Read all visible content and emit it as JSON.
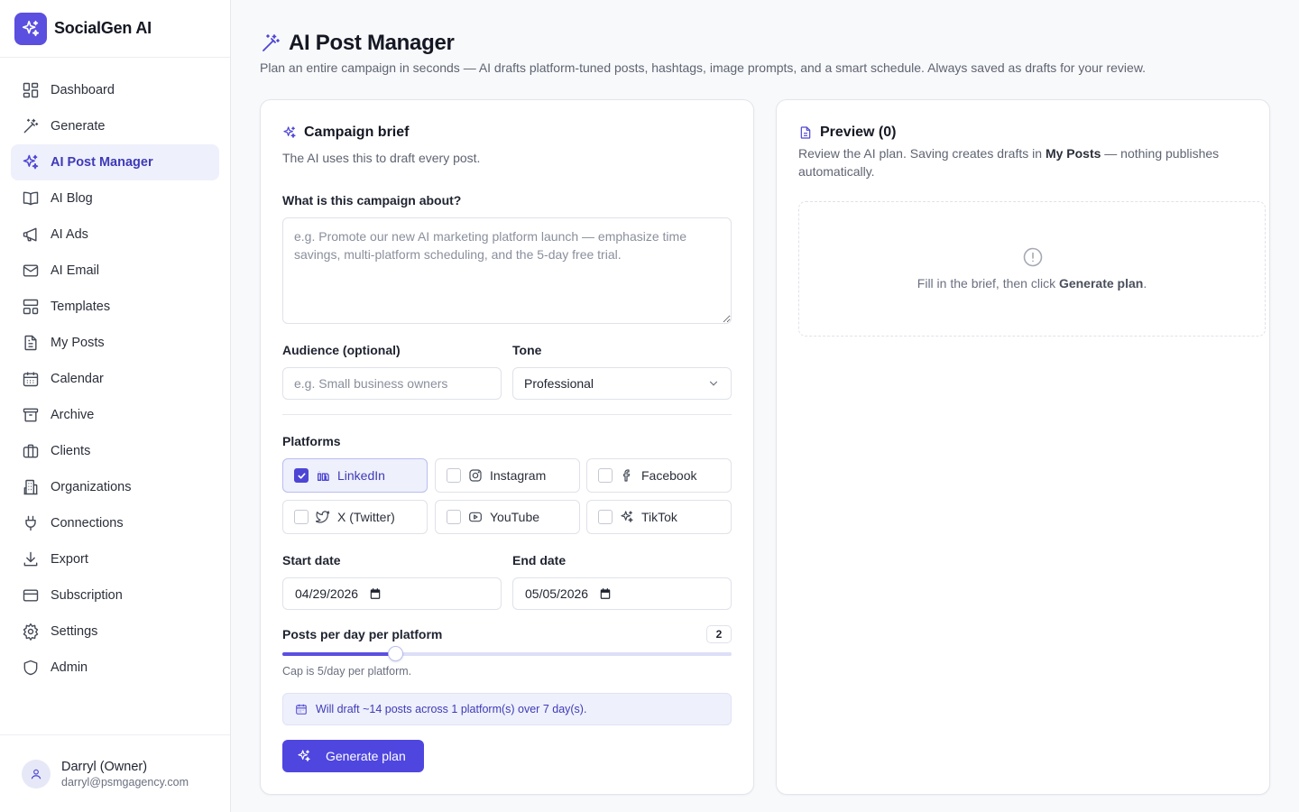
{
  "brand": {
    "name": "SocialGen AI"
  },
  "nav": [
    {
      "label": "Dashboard",
      "icon": "dashboard-icon"
    },
    {
      "label": "Generate",
      "icon": "wand-icon"
    },
    {
      "label": "AI Post Manager",
      "icon": "sparkles-icon",
      "active": true
    },
    {
      "label": "AI Blog",
      "icon": "book-icon"
    },
    {
      "label": "AI Ads",
      "icon": "megaphone-icon"
    },
    {
      "label": "AI Email",
      "icon": "mail-icon"
    },
    {
      "label": "Templates",
      "icon": "templates-icon"
    },
    {
      "label": "My Posts",
      "icon": "file-text-icon"
    },
    {
      "label": "Calendar",
      "icon": "calendar-icon"
    },
    {
      "label": "Archive",
      "icon": "archive-icon"
    },
    {
      "label": "Clients",
      "icon": "briefcase-icon"
    },
    {
      "label": "Organizations",
      "icon": "building-icon"
    },
    {
      "label": "Connections",
      "icon": "plug-icon"
    },
    {
      "label": "Export",
      "icon": "download-icon"
    },
    {
      "label": "Subscription",
      "icon": "credit-card-icon"
    },
    {
      "label": "Settings",
      "icon": "gear-icon"
    },
    {
      "label": "Admin",
      "icon": "shield-icon"
    }
  ],
  "user": {
    "name": "Darryl (Owner)",
    "email": "darryl@psmgagency.com"
  },
  "page": {
    "title": "AI Post Manager",
    "subtitle": "Plan an entire campaign in seconds — AI drafts platform-tuned posts, hashtags, image prompts, and a smart schedule. Always saved as drafts for your review."
  },
  "brief": {
    "title": "Campaign brief",
    "description": "The AI uses this to draft every post.",
    "about_label": "What is this campaign about?",
    "about_placeholder": "e.g. Promote our new AI marketing platform launch — emphasize time savings, multi-platform scheduling, and the 5-day free trial.",
    "about_value": "",
    "audience_label": "Audience (optional)",
    "audience_placeholder": "e.g. Small business owners",
    "tone_label": "Tone",
    "tone_value": "Professional",
    "platforms_label": "Platforms",
    "platforms": [
      {
        "label": "LinkedIn",
        "icon": "linkedin-icon",
        "checked": true
      },
      {
        "label": "Instagram",
        "icon": "instagram-icon",
        "checked": false
      },
      {
        "label": "Facebook",
        "icon": "facebook-icon",
        "checked": false
      },
      {
        "label": "X (Twitter)",
        "icon": "twitter-icon",
        "checked": false
      },
      {
        "label": "YouTube",
        "icon": "youtube-icon",
        "checked": false
      },
      {
        "label": "TikTok",
        "icon": "sparkles-icon",
        "checked": false
      }
    ],
    "start_label": "Start date",
    "start_value": "04/29/2026",
    "end_label": "End date",
    "end_value": "05/05/2026",
    "posts_label": "Posts per day per platform",
    "posts_value": "2",
    "posts_max": 5,
    "cap_text": "Cap is 5/day per platform.",
    "summary": "Will draft ~14 posts across 1 platform(s) over 7 day(s).",
    "generate_label": "Generate plan"
  },
  "preview": {
    "title": "Preview (0)",
    "desc_before": "Review the AI plan. Saving creates drafts in ",
    "desc_bold": "My Posts",
    "desc_after": " — nothing publishes automatically.",
    "empty_before": "Fill in the brief, then click ",
    "empty_bold": "Generate plan",
    "empty_after": "."
  },
  "colors": {
    "accent": "#4f46e0",
    "accent_soft": "#eef0fb",
    "text": "#1f2330",
    "muted": "#5f6472"
  }
}
